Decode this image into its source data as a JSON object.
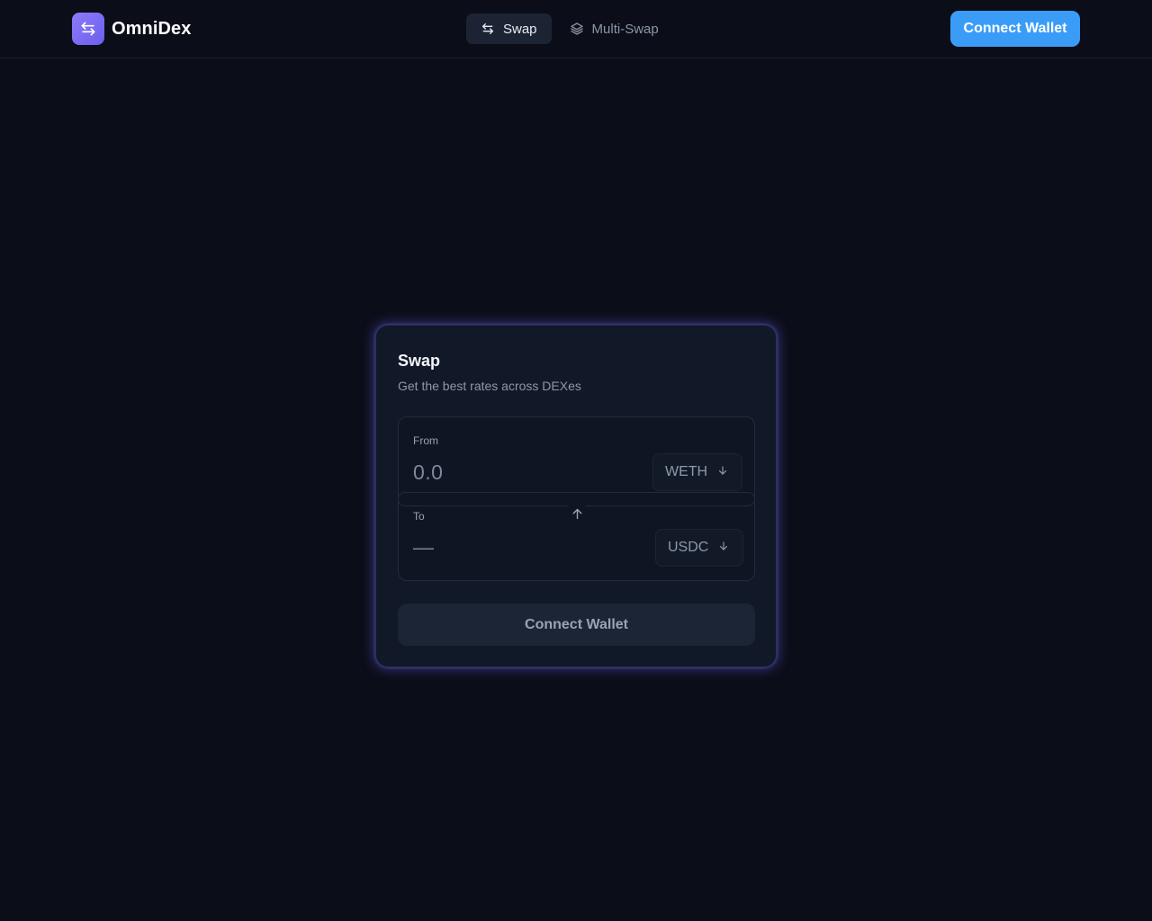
{
  "app": {
    "name": "OmniDex",
    "logo_icon": "swap-arrows-icon"
  },
  "nav": {
    "tabs": [
      {
        "label": "Swap",
        "icon": "swap-arrows-icon",
        "active": true
      },
      {
        "label": "Multi-Swap",
        "icon": "layers-icon",
        "active": false
      }
    ]
  },
  "header": {
    "connect_label": "Connect Wallet"
  },
  "swap": {
    "title": "Swap",
    "subtitle": "Get the best rates across DEXes",
    "from": {
      "label": "From",
      "amount_placeholder": "0.0",
      "token": "WETH",
      "token_icon": "arrow-down-icon"
    },
    "flip_icon": "arrow-up-icon",
    "to": {
      "label": "To",
      "amount": "—",
      "token": "USDC",
      "token_icon": "arrow-down-icon"
    },
    "connect_label": "Connect Wallet"
  },
  "colors": {
    "background": "#0b0e18",
    "accent": "#3b9cf7",
    "brand": "#7c6cf3",
    "card": "#111827"
  }
}
